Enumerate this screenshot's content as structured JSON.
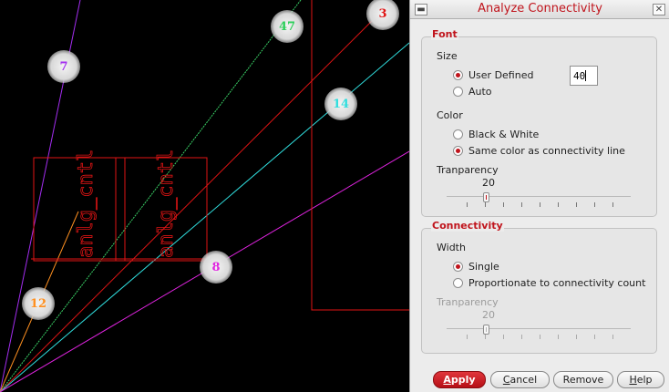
{
  "canvas": {
    "cell_label": "anlg_cntl",
    "badges": [
      {
        "label": "47",
        "color": "#2ecf5b"
      },
      {
        "label": "3",
        "color": "#e01414"
      },
      {
        "label": "7",
        "color": "#a32df0"
      },
      {
        "label": "14",
        "color": "#30dede"
      },
      {
        "label": "8",
        "color": "#e024e0"
      },
      {
        "label": "12",
        "color": "#ff9020"
      }
    ]
  },
  "dialog": {
    "title": "Analyze Connectivity",
    "font_group": {
      "title": "Font",
      "size_label": "Size",
      "size_options": [
        {
          "label": "User Defined",
          "selected": true
        },
        {
          "label": "Auto",
          "selected": false
        }
      ],
      "size_value": "40",
      "color_label": "Color",
      "color_options": [
        {
          "label": "Black & White",
          "selected": false
        },
        {
          "label": "Same color as connectivity line",
          "selected": true
        }
      ],
      "transparency_label": "Tranparency",
      "transparency_value": "20"
    },
    "connectivity_group": {
      "title": "Connectivity",
      "width_label": "Width",
      "width_options": [
        {
          "label": "Single",
          "selected": true
        },
        {
          "label": "Proportionate to connectivity count",
          "selected": false
        }
      ],
      "transparency_label": "Tranparency",
      "transparency_value": "20",
      "transparency_disabled": true
    },
    "buttons": {
      "apply_first": "A",
      "apply_rest": "pply",
      "cancel_first": "C",
      "cancel_rest": "ancel",
      "remove": "Remove",
      "help_first": "H",
      "help_rest": "elp"
    },
    "colors": {
      "accent": "#c0141c"
    }
  }
}
